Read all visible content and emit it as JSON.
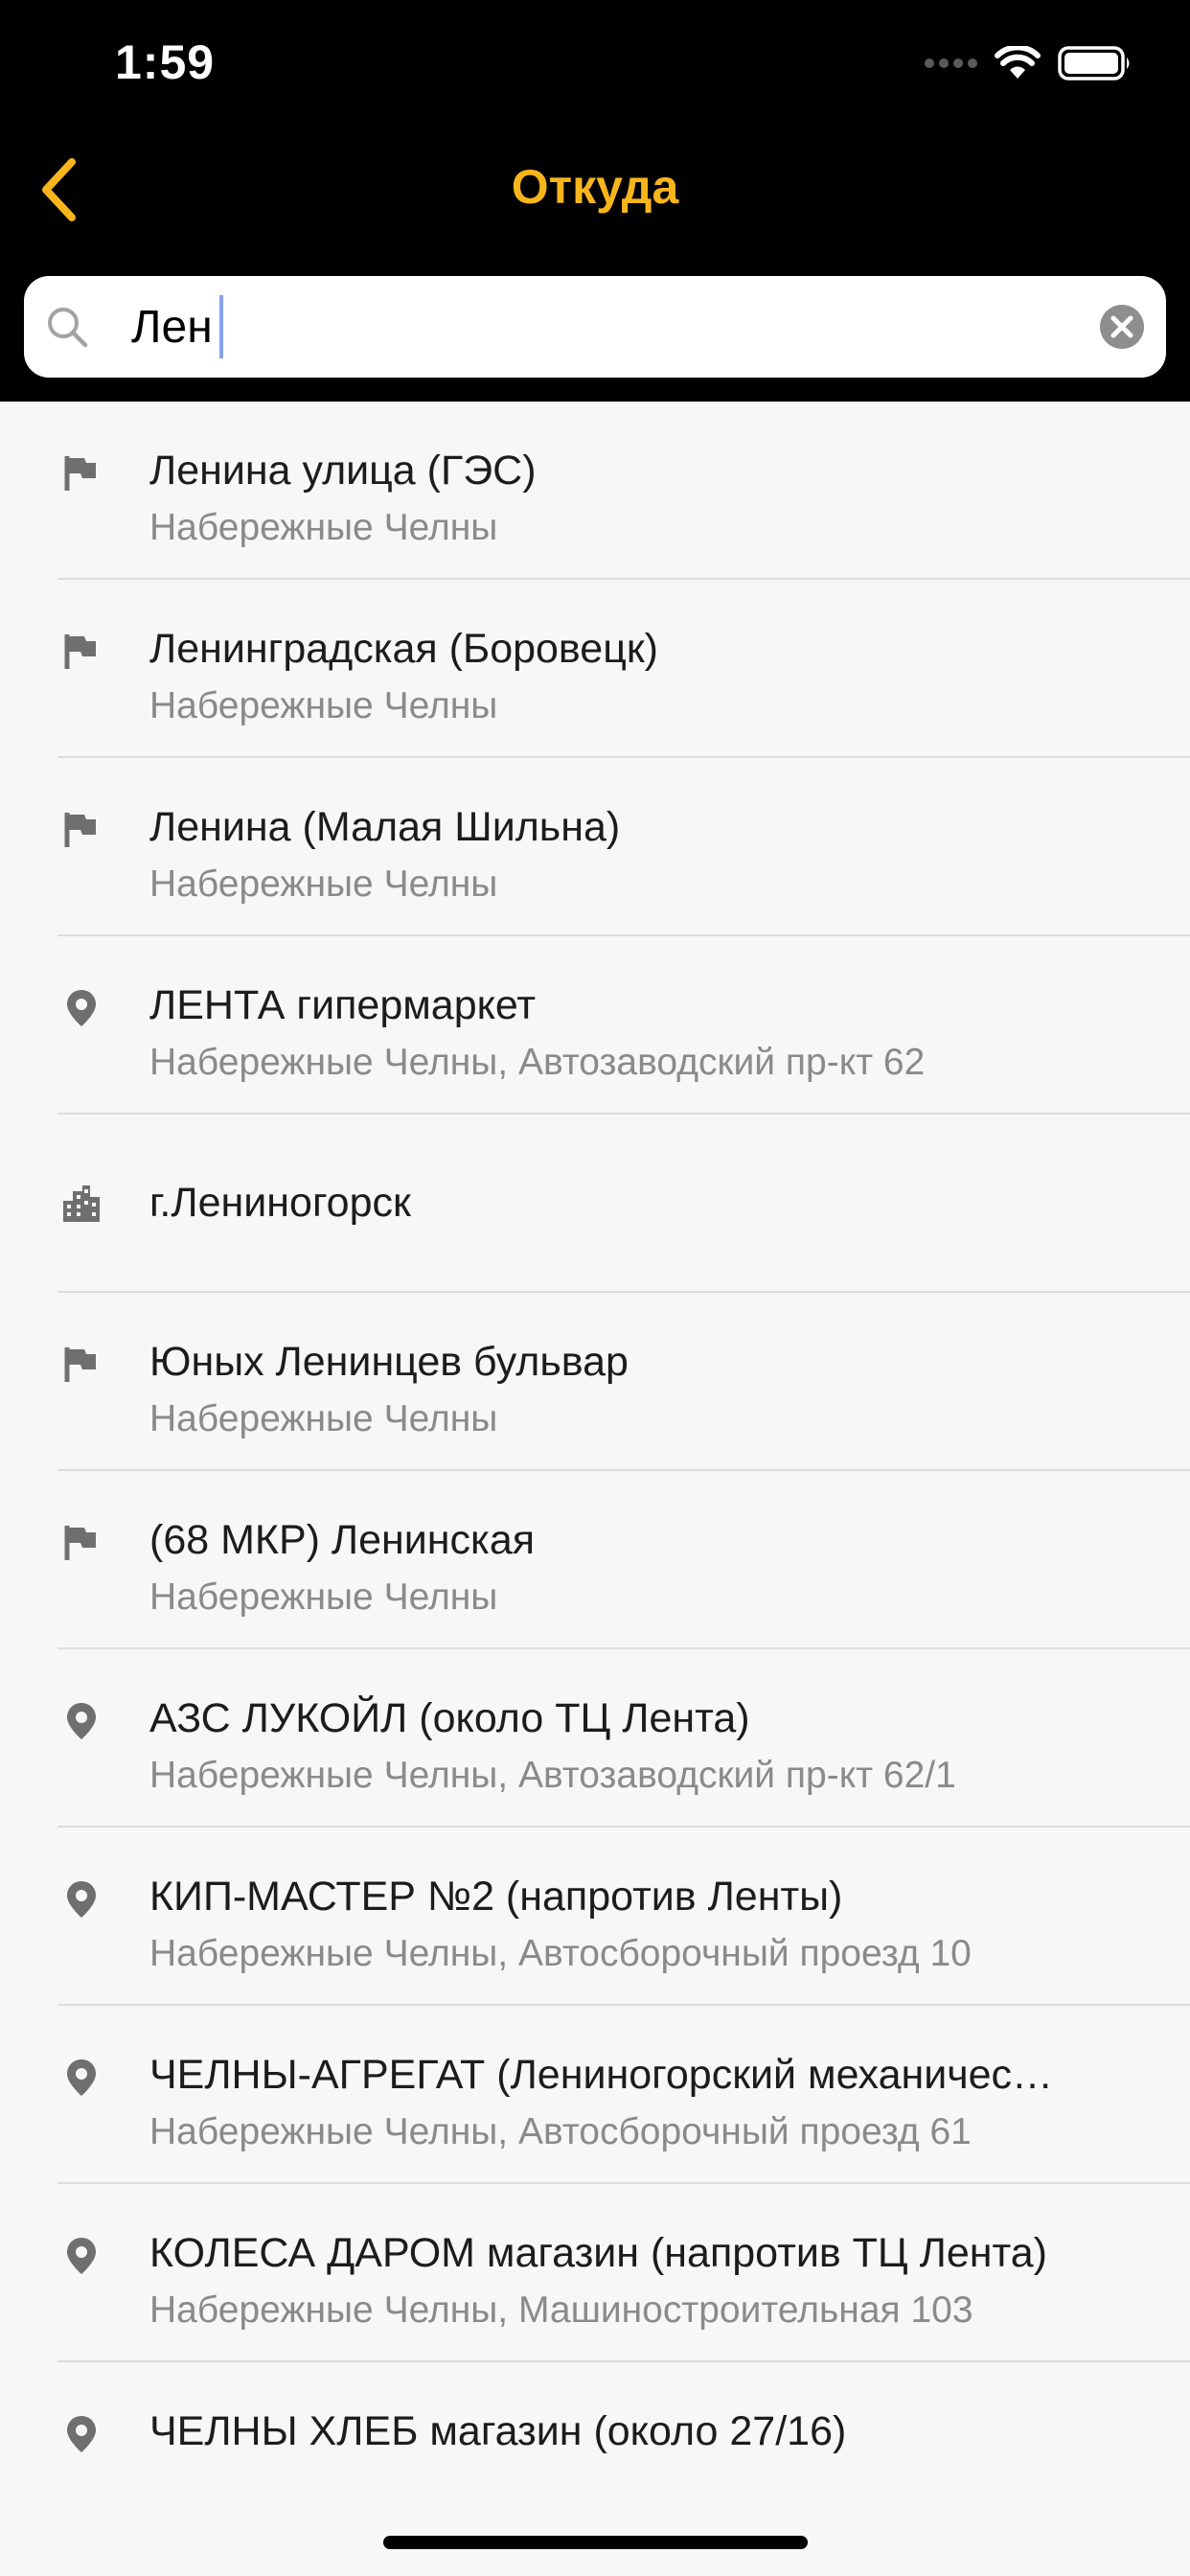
{
  "status_bar": {
    "time": "1:59"
  },
  "nav": {
    "title": "Откуда"
  },
  "search": {
    "value": "Лен"
  },
  "colors": {
    "accent": "#f6b51b",
    "header_bg": "#000000",
    "list_bg": "#f7f7f7",
    "title_text": "#1c1c1c",
    "subtitle_text": "#8a8a8a",
    "icon": "#6f6f6f"
  },
  "results": [
    {
      "icon": "flag-icon",
      "title": "Ленина улица (ГЭС)",
      "subtitle": "Набережные Челны"
    },
    {
      "icon": "flag-icon",
      "title": "Ленинградская (Боровецк)",
      "subtitle": "Набережные Челны"
    },
    {
      "icon": "flag-icon",
      "title": "Ленина (Малая Шильна)",
      "subtitle": "Набережные Челны"
    },
    {
      "icon": "location-pin-icon",
      "title": "ЛЕНТА гипермаркет",
      "subtitle": "Набережные Челны, Автозаводский пр-кт 62"
    },
    {
      "icon": "city-icon",
      "title": "г.Лениногорск",
      "subtitle": ""
    },
    {
      "icon": "flag-icon",
      "title": "Юных Ленинцев бульвар",
      "subtitle": "Набережные Челны"
    },
    {
      "icon": "flag-icon",
      "title": "(68 МКР) Ленинская",
      "subtitle": "Набережные Челны"
    },
    {
      "icon": "location-pin-icon",
      "title": "АЗС ЛУКОЙЛ (около ТЦ Лента)",
      "subtitle": "Набережные Челны, Автозаводский пр-кт 62/1"
    },
    {
      "icon": "location-pin-icon",
      "title": "КИП-МАСТЕР №2 (напротив Ленты)",
      "subtitle": "Набережные Челны, Автосборочный проезд 10"
    },
    {
      "icon": "location-pin-icon",
      "title": "ЧЕЛНЫ-АГРЕГАТ (Лениногорский механичес…",
      "subtitle": "Набережные Челны, Автосборочный проезд 61"
    },
    {
      "icon": "location-pin-icon",
      "title": "КОЛЕСА ДАРОМ магазин (напротив ТЦ Лента)",
      "subtitle": "Набережные Челны, Машиностроительная 103"
    },
    {
      "icon": "location-pin-icon",
      "title": "ЧЕЛНЫ ХЛЕБ магазин (около 27/16)",
      "subtitle": ""
    }
  ]
}
